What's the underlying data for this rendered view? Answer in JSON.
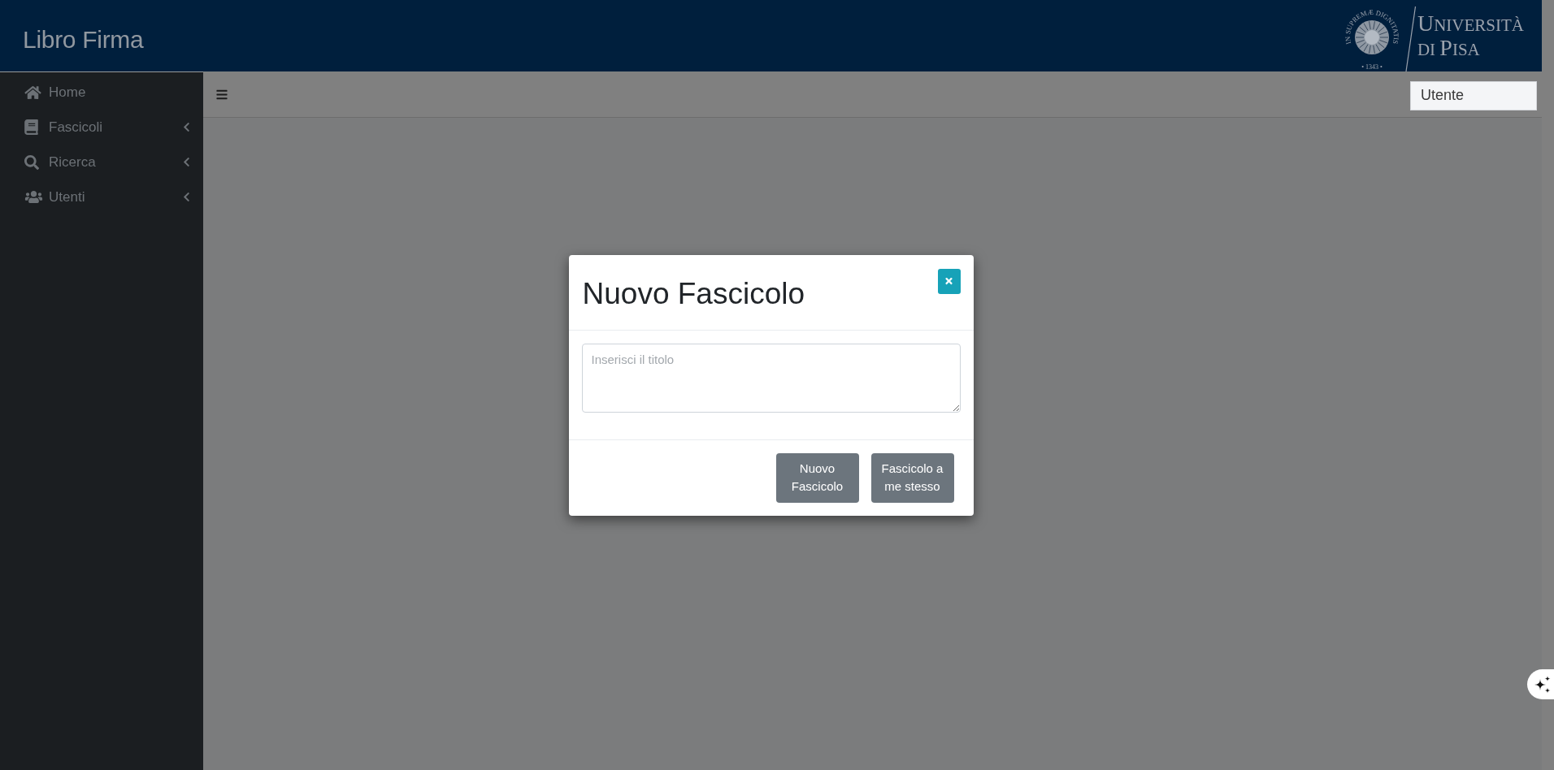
{
  "header": {
    "title": "Libro Firma",
    "logo": {
      "seal_motto": "IN SUPREMÆ DIGNITATIS",
      "seal_year": "• 1343 •",
      "line_1": "UNIVERSITÀ",
      "line_2": "DI PISA"
    }
  },
  "sidebar": {
    "items": [
      {
        "label": "Home"
      },
      {
        "label": "Fascicoli",
        "expanded": false
      },
      {
        "label": "Ricerca",
        "expanded": false
      },
      {
        "label": "Utenti",
        "expanded": false
      }
    ]
  },
  "toolbar": {
    "user_menu": "Utente"
  },
  "modal": {
    "title": "Nuovo Fascicolo",
    "title_field": {
      "placeholder": "Inserisci il titolo"
    },
    "buttons": [
      "Nuovo Fascicolo",
      "Fascicolo a me stesso"
    ]
  }
}
